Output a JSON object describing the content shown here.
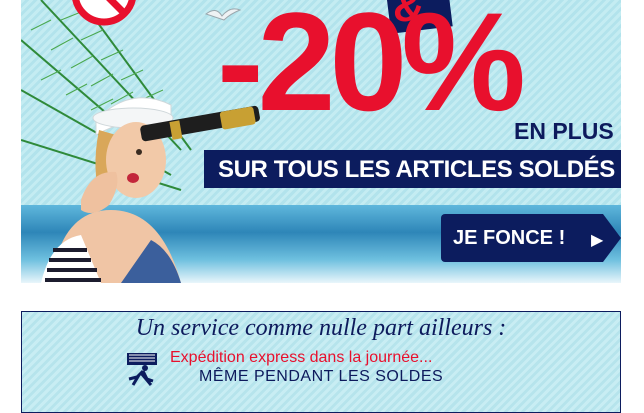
{
  "hero": {
    "amp": "&",
    "discount": "-20%",
    "en_plus": "EN PLUS",
    "sur_articles": "SUR TOUS LES ARTICLES SOLDÉS",
    "asterisk": "*",
    "cta_label": "JE FONCE !",
    "cta_arrow": "▶",
    "colors": {
      "red": "#e8102d",
      "navy": "#0c1c5e",
      "sky": "#c4ecf2"
    }
  },
  "service": {
    "title": "Un service comme nulle part ailleurs :",
    "line1": "Expédition express dans la journée...",
    "line2": "MÊME PENDANT LES SOLDES",
    "icon": "delivery-runner-icon"
  }
}
